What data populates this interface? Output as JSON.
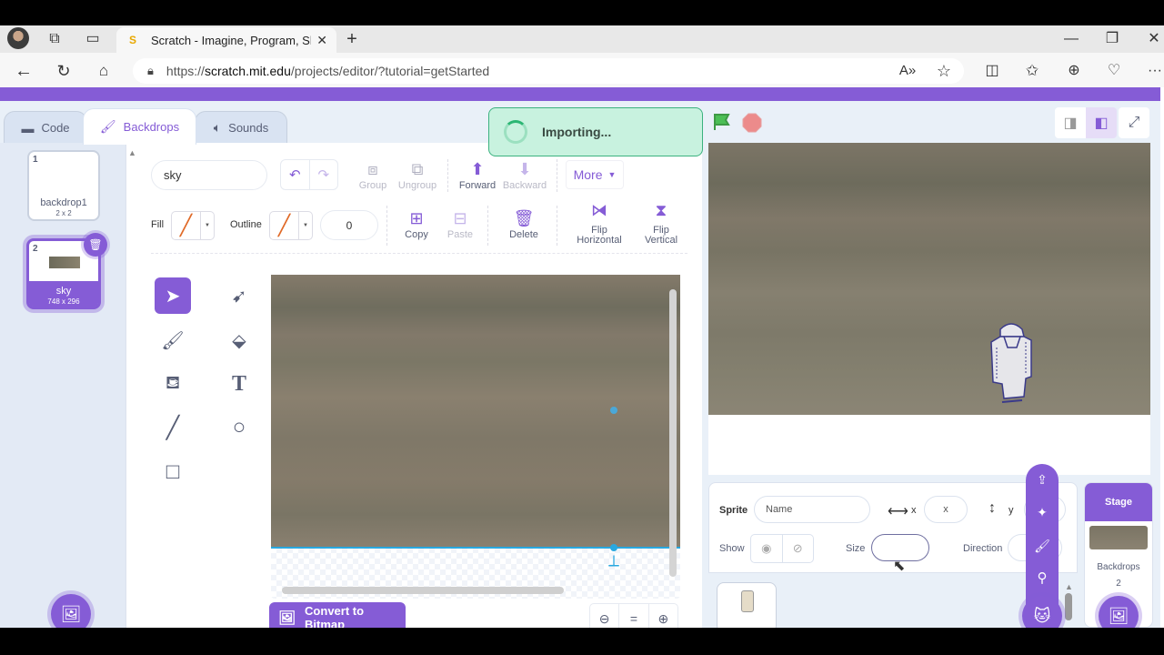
{
  "browser": {
    "tab_title": "Scratch - Imagine, Program, Shar",
    "url_prefix": "https://",
    "url_domain": "scratch.mit.edu",
    "url_path": "/projects/editor/?tutorial=getStarted",
    "new_tab": "+",
    "window_controls": {
      "minimize": "—",
      "maximize": "❐",
      "close": "✕"
    },
    "more": "···"
  },
  "editor_tabs": [
    {
      "label": "Code",
      "icon": "code-icon"
    },
    {
      "label": "Backdrops",
      "icon": "brush-icon"
    },
    {
      "label": "Sounds",
      "icon": "speaker-icon"
    }
  ],
  "costumes": [
    {
      "num": "1",
      "name": "backdrop1",
      "size": "2 x 2"
    },
    {
      "num": "2",
      "name": "sky",
      "size": "748 x 296"
    }
  ],
  "paint": {
    "costume_name": "sky",
    "group": "Group",
    "ungroup": "Ungroup",
    "forward": "Forward",
    "backward": "Backward",
    "more": "More",
    "fill_label": "Fill",
    "outline_label": "Outline",
    "outline_width": "0",
    "copy": "Copy",
    "paste": "Paste",
    "delete": "Delete",
    "flip_h_1": "Flip",
    "flip_h_2": "Horizontal",
    "flip_v_1": "Flip",
    "flip_v_2": "Vertical",
    "convert": "Convert to Bitmap",
    "zoom_reset": "="
  },
  "notification": {
    "text": "Importing..."
  },
  "sprite_info": {
    "sprite_label": "Sprite",
    "name_placeholder": "Name",
    "x_label": "x",
    "x_placeholder": "x",
    "y_label": "y",
    "show_label": "Show",
    "size_label": "Size",
    "direction_label": "Direction"
  },
  "stage_panel": {
    "title": "Stage",
    "backdrops_label": "Backdrops",
    "backdrops_count": "2"
  },
  "colors": {
    "accent": "#855cd6",
    "notification_bg": "#c8f2df",
    "green_flag": "#4cbf56",
    "stop": "#ec5959"
  }
}
